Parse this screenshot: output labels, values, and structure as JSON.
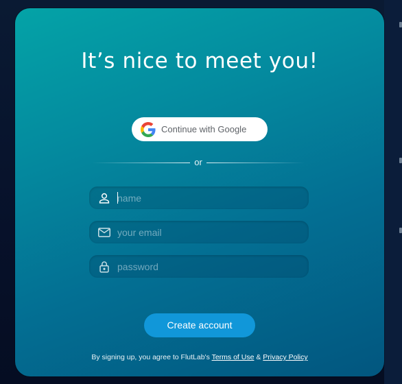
{
  "card": {
    "title": "It’s nice to meet you!"
  },
  "google_button": {
    "icon": "google-g-icon",
    "label": "Continue with Google"
  },
  "divider": {
    "text": "or"
  },
  "form": {
    "name": {
      "icon": "person-icon",
      "placeholder": "name",
      "value": ""
    },
    "email": {
      "icon": "mail-icon",
      "placeholder": "your email",
      "value": ""
    },
    "password": {
      "icon": "lock-icon",
      "placeholder": "password",
      "value": ""
    }
  },
  "create_button": {
    "label": "Create account"
  },
  "legal": {
    "prefix": "By signing up, you agree to FlutLab's ",
    "terms_link": "Terms of Use",
    "joiner": " & ",
    "privacy_link": "Privacy Policy"
  },
  "colors": {
    "card_gradient_start": "#04a3a7",
    "card_gradient_end": "#02567f",
    "primary_button": "#1197d9",
    "background": "#081329"
  }
}
